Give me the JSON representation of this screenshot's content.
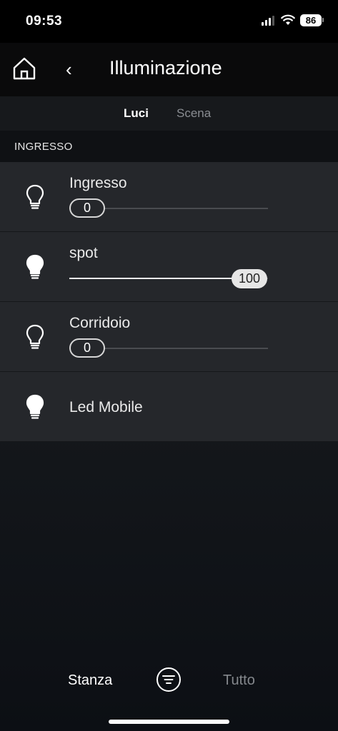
{
  "status_bar": {
    "time": "09:53",
    "battery": "86"
  },
  "header": {
    "title": "Illuminazione",
    "back_glyph": "‹"
  },
  "tabs": [
    {
      "label": "Luci",
      "active": true
    },
    {
      "label": "Scena",
      "active": false
    }
  ],
  "section": {
    "label": "INGRESSO"
  },
  "lights": [
    {
      "name": "Ingresso",
      "icon": "bulb-outline-icon",
      "on": false,
      "dimmable": true,
      "level": 0,
      "level_label": "0"
    },
    {
      "name": "spot",
      "icon": "bulb-filled-icon",
      "on": true,
      "dimmable": true,
      "level": 100,
      "level_label": "100"
    },
    {
      "name": "Corridoio",
      "icon": "bulb-outline-icon",
      "on": false,
      "dimmable": true,
      "level": 0,
      "level_label": "0"
    },
    {
      "name": "Led Mobile",
      "icon": "bulb-filled-icon",
      "on": true,
      "dimmable": false
    }
  ],
  "bottom_nav": {
    "left_label": "Stanza",
    "right_label": "Tutto"
  },
  "colors": {
    "accent_on": "#e6e6e6",
    "track": "#4a4c50",
    "row_bg": "#25272b",
    "inactive_text": "#85888d"
  }
}
